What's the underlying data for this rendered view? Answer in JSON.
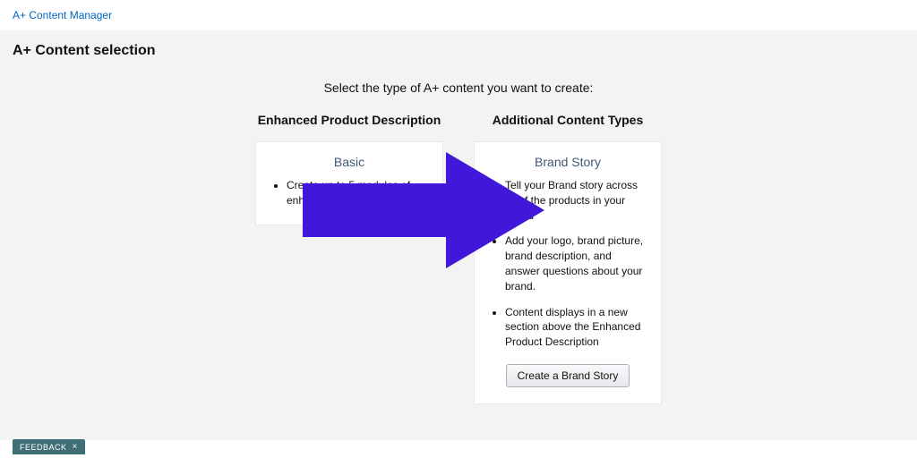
{
  "topbar": {
    "breadcrumb": "A+ Content Manager"
  },
  "page": {
    "title": "A+ Content selection",
    "prompt": "Select the type of A+ content you want to create:"
  },
  "columns": {
    "left": {
      "heading": "Enhanced Product Description",
      "card": {
        "title": "Basic",
        "bullets": [
          "Create up to 5 modules of enhanced content."
        ]
      }
    },
    "right": {
      "heading": "Additional Content Types",
      "card": {
        "title": "Brand Story",
        "bullets": [
          "Tell your Brand story across all of the products in your Brand",
          "Add your logo, brand picture, brand description, and answer questions about your brand.",
          "Content displays in a new section above the Enhanced Product Description"
        ],
        "button": "Create a Brand Story"
      }
    }
  },
  "overlay": {
    "arrow_color": "#4118d9"
  },
  "feedback": {
    "label": "FEEDBACK",
    "close": "×"
  }
}
